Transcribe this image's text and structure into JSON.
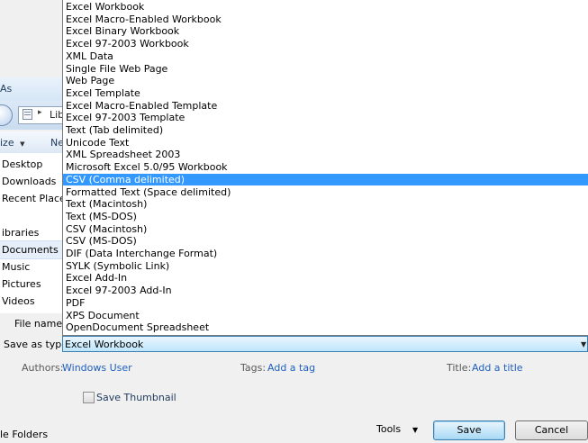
{
  "dialog": {
    "title_fragment": "As",
    "address_fragment": "Lib",
    "address_separator": "▸",
    "organize_fragment": "ize",
    "organize_arrow": "▼",
    "new_folder_fragment": "Ne"
  },
  "navigation": {
    "items": [
      {
        "label": "Desktop"
      },
      {
        "label": "Downloads"
      },
      {
        "label": "Recent Places"
      },
      {
        "label": "ibraries"
      },
      {
        "label": "Documents"
      },
      {
        "label": "Music"
      },
      {
        "label": "Pictures"
      },
      {
        "label": "Videos"
      }
    ],
    "selected_index": 4
  },
  "fields": {
    "file_name_label": "File name:",
    "save_as_type_label": "Save as type:",
    "save_as_type_value": "Excel Workbook",
    "dropdown_arrow": "▼"
  },
  "file_types": [
    "Excel Workbook",
    "Excel Macro-Enabled Workbook",
    "Excel Binary Workbook",
    "Excel 97-2003 Workbook",
    "XML Data",
    "Single File Web Page",
    "Web Page",
    "Excel Template",
    "Excel Macro-Enabled Template",
    "Excel 97-2003 Template",
    "Text (Tab delimited)",
    "Unicode Text",
    "XML Spreadsheet 2003",
    "Microsoft Excel 5.0/95 Workbook",
    "CSV (Comma delimited)",
    "Formatted Text (Space delimited)",
    "Text (Macintosh)",
    "Text (MS-DOS)",
    "CSV (Macintosh)",
    "CSV (MS-DOS)",
    "DIF (Data Interchange Format)",
    "SYLK (Symbolic Link)",
    "Excel Add-In",
    "Excel 97-2003 Add-In",
    "PDF",
    "XPS Document",
    "OpenDocument Spreadsheet"
  ],
  "highlighted_file_type_index": 14,
  "metadata": {
    "authors_label": "Authors:",
    "authors_value": "Windows User",
    "tags_label": "Tags:",
    "tags_value": "Add a tag",
    "title_label": "Title:",
    "title_value": "Add a title"
  },
  "options": {
    "save_thumbnail_label": "Save Thumbnail",
    "save_thumbnail_checked": false
  },
  "footer": {
    "hide_folders_fragment": "le Folders",
    "tools_label": "Tools",
    "tools_arrow": "▼",
    "save_label": "Save",
    "cancel_label": "Cancel"
  },
  "colors": {
    "selection_blue": "#3399ff",
    "link_blue": "#1e5fbf",
    "dialog_background": "#f0f0f0"
  }
}
